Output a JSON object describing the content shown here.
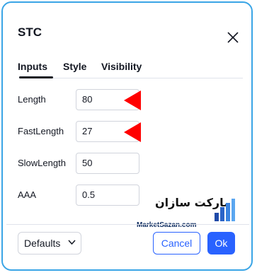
{
  "dialog": {
    "title": "STC"
  },
  "tabs": [
    {
      "label": "Inputs",
      "active": true
    },
    {
      "label": "Style"
    },
    {
      "label": "Visibility"
    }
  ],
  "inputs": [
    {
      "label": "Length",
      "value": "80"
    },
    {
      "label": "FastLength",
      "value": "27"
    },
    {
      "label": "SlowLength",
      "value": "50"
    },
    {
      "label": "AAA",
      "value": "0.5"
    }
  ],
  "footer": {
    "defaults_label": "Defaults",
    "cancel_label": "Cancel",
    "ok_label": "Ok"
  },
  "watermark": {
    "arabic": "مارکت سازان",
    "english": "MarketSazan.com"
  },
  "colors": {
    "accent": "#2962ff",
    "frame": "#3aa5e6",
    "annotation_arrow": "#ff0000"
  }
}
